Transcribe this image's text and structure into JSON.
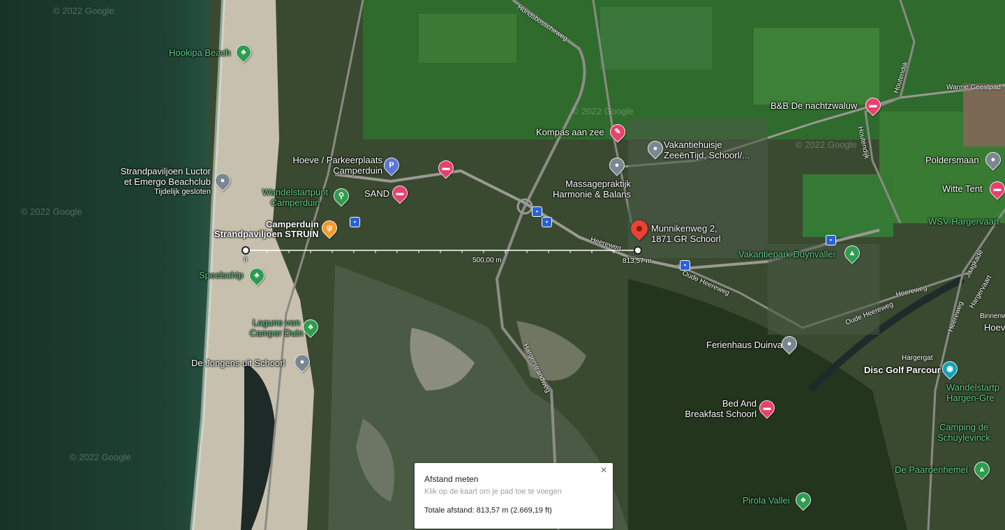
{
  "watermarks": [
    "© 2022 Google",
    "© 2022 Google",
    "© 2022 Google",
    "© 2022 Google",
    "© 2022 Google"
  ],
  "places": {
    "hookipa": "Hookipa Beach",
    "strandpaviljoen_luctor": "Strandpaviljoen Luctor",
    "emergo": "et Emergo Beachclub",
    "tijdelijk": "Tijdelijk gesloten",
    "wandelstart_1": "Wandelstartpunt",
    "wandelstart_2": "Camperduin",
    "hoeve_1": "Hoeve / Parkeerplaats",
    "hoeve_2": "Camperduin",
    "sand": "SAND",
    "camperduin": "Camperduin",
    "struin": "Strandpaviljoen STRUIN",
    "speelschip": "Speelschip",
    "lagune_1": "Lagune von",
    "lagune_2": "Camper Duin",
    "jongens": "De Jongens uit Schoorl",
    "kompas": "Kompas aan zee",
    "vakantiehuisje_1": "Vakantiehuisje",
    "vakantiehuisje_2": "ZeeënTijd, Schoorl/...",
    "massage_1": "Massagepraktijk",
    "massage_2": "Harmonie & Balans",
    "munnikenweg_1": "Munnikenweg 2,",
    "munnikenweg_2": "1871 GR Schoorl",
    "bnb_nacht": "B&B De nachtzwaluw",
    "poldersmaan": "Poldersmaan",
    "witte_tent": "Witte Tent",
    "wsv": "WSV Hargervaart",
    "duynvallei": "Vakantiepark Duynvallei",
    "ferienhaus": "Ferienhaus Duinvallei",
    "disc_golf": "Disc Golf Parcour",
    "wandel_hargen_1": "Wandelstartp",
    "wandel_hargen_2": "Hargen-Gre",
    "bnb_schoorl_1": "Bed And",
    "bnb_schoorl_2": "Breakfast Schoorl",
    "schuylevinck_1": "Camping de",
    "schuylevinck_2": "Schuylevinck",
    "paardenhemel": "De Paardenhemel",
    "pirola": "Pirola Vallei",
    "hoev": "Hoev"
  },
  "roads": {
    "hondsbossche": "Hondsbosscheweg",
    "heereweg_1": "Heereweg",
    "heereweg_2": "Heereweg",
    "heereweg_3": "Heereweg",
    "oude_heereweg_1": "Oude Heereweg",
    "oude_heereweg_2": "Oude Heereweg",
    "hargerstrandweg": "Hargerstrandweg",
    "houtendijk_1": "Houtendijk",
    "houtendijk_2": "Houtendijk",
    "warme_geestpad": "Warme Geestpad",
    "jaagkade": "Jaagkade",
    "hargervaart": "Hargervaart",
    "hargergat": "Hargergat",
    "binnenweg": "Binnenw"
  },
  "measure": {
    "start_label": "0",
    "mid_label": "500,00 m",
    "end_label": "813,57 m"
  },
  "panel": {
    "title": "Afstand meten",
    "hint": "Klik op de kaart om je pad toe te voegen",
    "total": "Totale afstand: 813,57 m (2.669,19 ft)",
    "close_icon": "×"
  },
  "icons": {
    "hookipa": "park-pin-icon",
    "luctor": "place-pin-icon",
    "wandelstart": "hiking-pin-icon",
    "hoeve": "parking-pin-icon",
    "sand": "hotel-pin-icon",
    "camperduin": "restaurant-pin-icon",
    "speelschip": "park-pin-icon",
    "lagune": "park-pin-icon",
    "jongens": "place-pin-icon",
    "kompas": "spa-pin-icon",
    "vakantiehuisje": "place-pin-icon",
    "massage": "place-pin-icon",
    "bnb_nacht": "hotel-pin-icon",
    "poldersmaan": "place-pin-icon",
    "witte_tent": "hotel-pin-icon",
    "duynvallei": "campground-pin-icon",
    "ferienhaus": "place-pin-icon",
    "disc_golf": "camera-pin-icon",
    "bnb_schoorl": "hotel-pin-icon",
    "paardenhemel": "campground-pin-icon",
    "pirola": "park-pin-icon"
  },
  "colors": {
    "measure_line": "#ffffff",
    "selected_pin": "#ea4335",
    "park_pin": "#2f9c4f",
    "hotel_pin": "#e8416e",
    "bus_stop": "#2a62d6"
  }
}
